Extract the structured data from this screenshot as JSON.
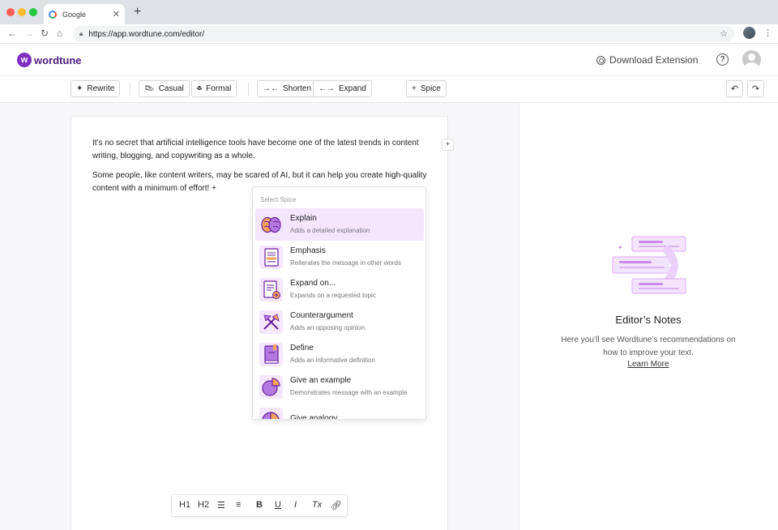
{
  "browser": {
    "tab_title": "Google",
    "tab_close": "✕",
    "new_tab": "+",
    "url": "https://app.wordtune.com/editor/"
  },
  "app": {
    "logo_text": "wordtune",
    "download_extension": "Download Extension",
    "brand_color": "#7f2ec1"
  },
  "toolbar": {
    "rewrite": "Rewrite",
    "casual": "Casual",
    "formal": "Formal",
    "shorten": "Shorten",
    "expand": "Expand",
    "spice": "Spice"
  },
  "document": {
    "paragraph1": "It's no secret that artificial intelligence tools have become one of the latest trends in content writing, blogging, and copywriting as a whole.",
    "paragraph2": "Some people, like content writers, may be scared of AI, but it can help you create high-quality content with a minimum of effort! +"
  },
  "spice_menu": {
    "header": "Select Spice",
    "items": [
      {
        "name": "Explain",
        "desc": "Adds a detailed explanation",
        "icon": "brain-icon",
        "active": true
      },
      {
        "name": "Emphasis",
        "desc": "Reiterates the message in other words",
        "icon": "document-icon"
      },
      {
        "name": "Expand on...",
        "desc": "Expands on a requested topic",
        "icon": "document-plus-icon"
      },
      {
        "name": "Counterargument",
        "desc": "Adds an opposing opinion",
        "icon": "arrows-icon"
      },
      {
        "name": "Define",
        "desc": "Adds an informative definition",
        "icon": "book-icon"
      },
      {
        "name": "Give an example",
        "desc": "Demonstrates message with an example",
        "icon": "pie-chart-icon"
      },
      {
        "name": "Give analogy",
        "desc": "",
        "icon": "pie-icon"
      }
    ]
  },
  "format_bar": {
    "h1": "H1",
    "h2": "H2",
    "bold": "B",
    "underline": "U",
    "italic": "I",
    "clear": "Tx"
  },
  "notes": {
    "title": "Editor’s Notes",
    "body": "Here you’ll see Wordtune’s recommendations on how to improve your text.",
    "learn_more": "Learn More"
  }
}
